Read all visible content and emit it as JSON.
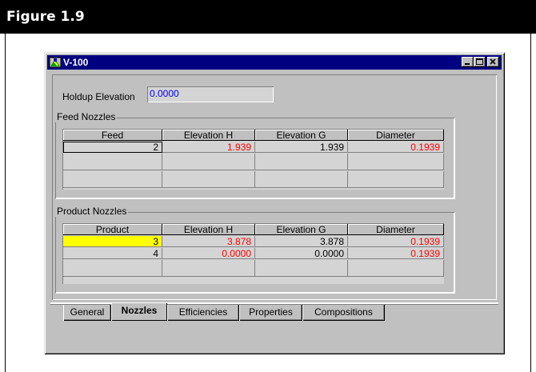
{
  "figure": {
    "title": "Figure 1.9"
  },
  "window": {
    "title": "V-100",
    "controls": {
      "minimize": "minimize",
      "maximize": "maximize",
      "close": "close"
    }
  },
  "holdup": {
    "label": "Holdup Elevation",
    "value": "0.0000"
  },
  "feed_nozzles": {
    "group_label": "Feed Nozzles",
    "columns": [
      "Feed",
      "Elevation H",
      "Elevation G",
      "Diameter"
    ],
    "rows": [
      [
        "2",
        "1.939",
        "1.939",
        "0.1939"
      ],
      [
        "",
        "",
        "",
        ""
      ],
      [
        "",
        "",
        "",
        ""
      ]
    ]
  },
  "product_nozzles": {
    "group_label": "Product Nozzles",
    "columns": [
      "Product",
      "Elevation H",
      "Elevation G",
      "Diameter"
    ],
    "rows": [
      [
        "3",
        "3.878",
        "3.878",
        "0.1939"
      ],
      [
        "4",
        "0.0000",
        "0.0000",
        "0.1939"
      ],
      [
        "",
        "",
        "",
        ""
      ]
    ]
  },
  "tabs": [
    {
      "label": "General",
      "active": false
    },
    {
      "label": "Nozzles",
      "active": true
    },
    {
      "label": "Efficiencies",
      "active": false
    },
    {
      "label": "Properties",
      "active": false
    },
    {
      "label": "Compositions",
      "active": false
    }
  ],
  "colors": {
    "title_bar": "#000080",
    "specified_value": "#ff0000",
    "calculated_value": "#000000",
    "selected_cell": "#ffff00",
    "holdup_value": "#0000ff"
  }
}
